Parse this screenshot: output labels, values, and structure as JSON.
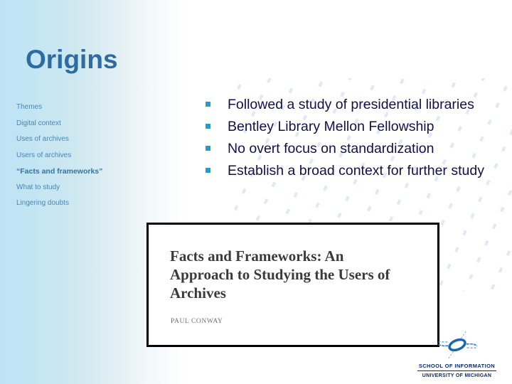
{
  "slide": {
    "title": "Origins",
    "accent_color": "#2d6ca2",
    "bullet_color": "#1f9fd0",
    "body_text_color": "#111149",
    "sidebar_color": "#4a86b8",
    "background_color": "#bee4f4"
  },
  "sidebar": {
    "items": [
      {
        "label": "Themes",
        "current": false
      },
      {
        "label": "Digital context",
        "current": false
      },
      {
        "label": "Uses of archives",
        "current": false
      },
      {
        "label": "Users of archives",
        "current": false
      },
      {
        "label": "“Facts and frameworks”",
        "current": true
      },
      {
        "label": "What to study",
        "current": false
      },
      {
        "label": "Lingering doubts",
        "current": false
      }
    ]
  },
  "bullets": {
    "marker": "square-bullet",
    "items": [
      "Followed a study of presidential libraries",
      "Bentley Library Mellon Fellowship",
      "No overt focus on standardization",
      "Establish a broad context for further study"
    ]
  },
  "article": {
    "title": "Facts and Frameworks: An Approach to Studying the Users of Archives",
    "author": "PAUL CONWAY"
  },
  "footer": {
    "logo_icon": "spiral-galaxy-logo",
    "line1": "SCHOOL OF INFORMATION",
    "line2": "UNIVERSITY OF MICHIGAN",
    "logo_color": "#1a66b3"
  }
}
